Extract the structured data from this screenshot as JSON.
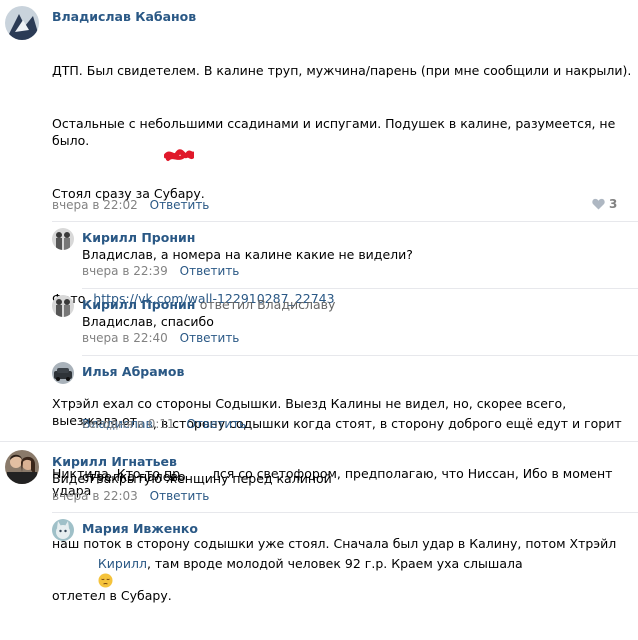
{
  "comments": [
    {
      "author": "Владислав Кабанов",
      "text_lines": [
        "ДТП. Был свидетелем. В калине труп, мужчина/парень (при мне сообщили и накрыли).",
        "Остальные с небольшими ссадинами и испугами. Подушек в калине, разумеется, не было.",
        "Стоял сразу за Субару."
      ],
      "photo_label": "Фото. ",
      "photo_link": "https://vk.com/wall-122910287_22743",
      "text2_lines": [
        "Хтрэйл ехал со стороны Содышки. Выезд Калины не видел, но, скорее всего, выезжала от",
        "Никтида. Кто-то пр        лся со светофором, предполагаю, что Ниссан, Ибо в момент удара",
        "наш поток в сторону содышки уже стоял. Сначала был удар в Калину, потом Хтрэйл",
        "отлетел в Субару."
      ],
      "time": "вчера в 22:02",
      "reply_label": "Ответить",
      "likes": "3"
    },
    {
      "author": "Кирилл Пронин",
      "text": "Владислав, а номера на калине какие не видели?",
      "time": "вчера в 22:39",
      "reply_label": "Ответить"
    },
    {
      "author": "Кирилл Пронин",
      "reply_to": "ответил Владиславу",
      "text": "Владислав, спасибо",
      "time": "вчера в 22:40",
      "reply_label": "Ответить"
    },
    {
      "author": "Илья Абрамов",
      "mention": "Владислав",
      "text_line1": ", в сторону содышки когда стоят, в сторону доброго ещё едут и горит",
      "text_line2": "стрелка налево",
      "time": "сегодня в 0:11",
      "reply_label": "Ответить"
    },
    {
      "author": "Кирилл Игнатьев",
      "text": "Видел закрытую женщину перед калиной",
      "time": "вчера в 22:03",
      "reply_label": "Ответить"
    },
    {
      "author": "Мария Ивженко",
      "mention": "Кирилл",
      "text": ", там вроде молодой человек 92 г.р. Краем уха слышала"
    }
  ],
  "colors": {
    "link": "#2a5885",
    "meta": "#828282",
    "divider": "#e7e8ec",
    "scribble": "#e0182a"
  },
  "icons": {
    "like": "heart-icon",
    "emoji": "pensive-face-emoji"
  }
}
